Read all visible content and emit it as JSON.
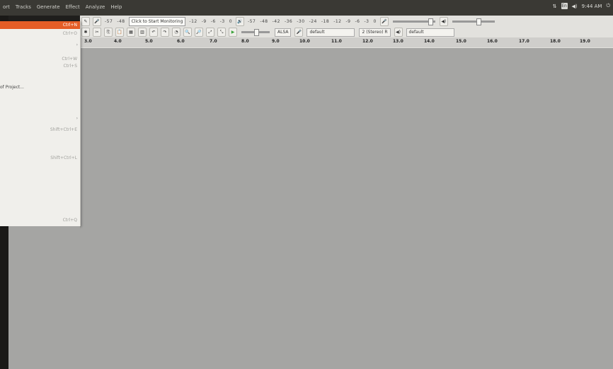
{
  "menubar": {
    "items": [
      "ort",
      "Tracks",
      "Generate",
      "Effect",
      "Analyze",
      "Help"
    ]
  },
  "indicators": {
    "clock": "9:44 AM",
    "keyboard": "En"
  },
  "toolbar": {
    "row1": {
      "meter_scale_left": [
        "-57",
        "-48"
      ],
      "monitor_label": "Click to Start Monitoring",
      "meter_scale_right": [
        "-12",
        "-9",
        "-6",
        "-3",
        "0"
      ],
      "play_scale": [
        "-57",
        "-48",
        "-42",
        "-36",
        "-30",
        "-24",
        "-18",
        "-12",
        "-9",
        "-6",
        "-3",
        "0"
      ]
    },
    "row2": {
      "host": "ALSA",
      "input_device": "default",
      "channels": "2 (Stereo) R",
      "output_device": "default"
    },
    "ruler": [
      "3.0",
      "4.0",
      "5.0",
      "6.0",
      "7.0",
      "8.0",
      "9.0",
      "10.0",
      "11.0",
      "12.0",
      "13.0",
      "14.0",
      "15.0",
      "16.0",
      "17.0",
      "18.0",
      "19.0"
    ]
  },
  "file_menu": {
    "items": [
      {
        "label": "",
        "accel": "Ctrl+N",
        "highlighted": true
      },
      {
        "label": "",
        "accel": "Ctrl+O",
        "highlighted": false
      },
      {
        "label": "",
        "accel": "",
        "highlighted": false,
        "submenu": true
      },
      {
        "label": "",
        "accel": "Ctrl+W",
        "highlighted": false
      },
      {
        "label": "",
        "accel": "Ctrl+S",
        "highlighted": false
      },
      {
        "label": "of Project...",
        "accel": "",
        "highlighted": false
      },
      {
        "label": "",
        "accel": "",
        "highlighted": false,
        "submenu": true
      },
      {
        "label": "",
        "accel": "Shift+Ctrl+E",
        "highlighted": false
      },
      {
        "label": "",
        "accel": "Shift+Ctrl+L",
        "highlighted": false
      },
      {
        "label": "",
        "accel": "Ctrl+Q",
        "highlighted": false
      }
    ]
  },
  "colors": {
    "accent": "#e45d26",
    "canvas": "#a5a5a3",
    "panel": "#3a3934"
  }
}
